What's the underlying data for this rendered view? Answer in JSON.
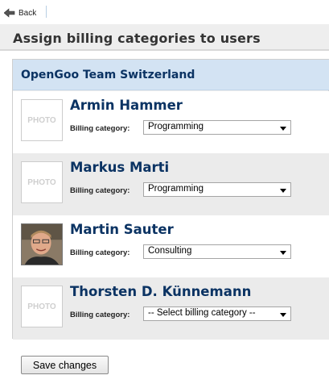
{
  "toolbar": {
    "back_label": "Back"
  },
  "page": {
    "title": "Assign billing categories to users"
  },
  "group": {
    "title": "OpenGoo Team Switzerland"
  },
  "users": [
    {
      "name": "Armin Hammer",
      "photo_placeholder": "PHOTO",
      "category_label": "Billing category:",
      "category_value": "Programming"
    },
    {
      "name": "Markus Marti",
      "photo_placeholder": "PHOTO",
      "category_label": "Billing category:",
      "category_value": "Programming"
    },
    {
      "name": "Martin Sauter",
      "photo_placeholder": "",
      "category_label": "Billing category:",
      "category_value": "Consulting"
    },
    {
      "name": "Thorsten D. Künnemann",
      "photo_placeholder": "PHOTO",
      "category_label": "Billing category:",
      "category_value": "-- Select billing category --"
    }
  ],
  "actions": {
    "save_label": "Save changes"
  }
}
